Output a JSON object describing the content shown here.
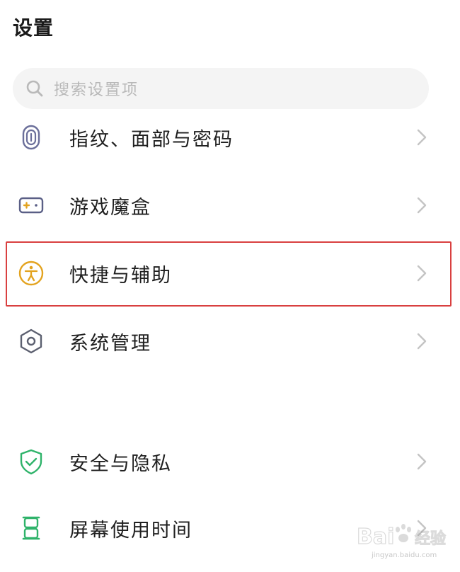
{
  "header": {
    "title": "设置"
  },
  "search": {
    "placeholder": "搜索设置项",
    "icon": "search-icon"
  },
  "settings": {
    "items": [
      {
        "label": "指纹、面部与密码",
        "icon": "fingerprint-icon",
        "icon_color": "#6b6f9a"
      },
      {
        "label": "游戏魔盒",
        "icon": "gamepad-icon",
        "icon_color": "#5a5f86"
      },
      {
        "label": "快捷与辅助",
        "icon": "accessibility-icon",
        "icon_color": "#e3a31f",
        "highlighted": true
      },
      {
        "label": "系统管理",
        "icon": "settings-hexagon-icon",
        "icon_color": "#5c6070"
      },
      {
        "label": "安全与隐私",
        "icon": "shield-check-icon",
        "icon_color": "#2fb36a"
      },
      {
        "label": "屏幕使用时间",
        "icon": "hourglass-icon",
        "icon_color": "#2fb36a"
      }
    ]
  },
  "colors": {
    "highlight_border": "#d94040",
    "search_background": "#f4f4f4",
    "chevron": "#c4c4c4"
  },
  "watermark": {
    "sub": "jingyan.baidu.com"
  }
}
